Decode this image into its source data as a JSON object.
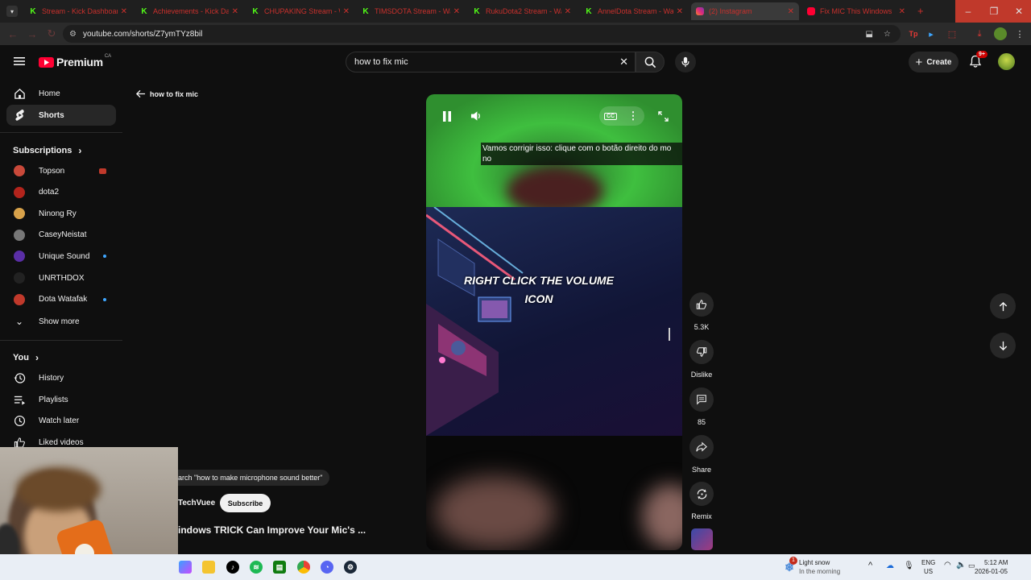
{
  "browser": {
    "tabs": [
      {
        "title": "Stream - Kick Dashboard",
        "favicon": "kick-icon"
      },
      {
        "title": "Achievements - Kick Dash",
        "favicon": "kick-icon"
      },
      {
        "title": "CHUPAKING Stream - Wa",
        "favicon": "kick-icon"
      },
      {
        "title": "TIMSDOTA Stream - Wa",
        "favicon": "kick-icon"
      },
      {
        "title": "RukuDota2 Stream - Wa",
        "favicon": "kick-icon"
      },
      {
        "title": "AnnelDota Stream - Wa",
        "favicon": "kick-icon"
      },
      {
        "title": "(2) Instagram",
        "favicon": "instagram-icon"
      },
      {
        "title": "Fix MIC This Windows",
        "favicon": "youtube-icon"
      }
    ],
    "new_tab": "+",
    "url": "youtube.com/shorts/Z7ymTYz8bil"
  },
  "youtube": {
    "logo_text": "Premium",
    "logo_region": "CA",
    "search_value": "how to fix mic",
    "create_label": "Create",
    "notification_badge": "9+"
  },
  "sidebar": {
    "main": [
      {
        "label": "Home",
        "icon": "home-icon"
      },
      {
        "label": "Shorts",
        "icon": "shorts-icon"
      }
    ],
    "subscriptions_heading": "Subscriptions",
    "subscriptions": [
      {
        "label": "Topson",
        "color": "#c9493a",
        "live": "red"
      },
      {
        "label": "dota2",
        "color": "#b3241c",
        "live": ""
      },
      {
        "label": "Ninong Ry",
        "color": "#d8a24a",
        "live": ""
      },
      {
        "label": "CaseyNeistat",
        "color": "#777777",
        "live": ""
      },
      {
        "label": "Unique Sound",
        "color": "#5a2ea6",
        "live": "blue"
      },
      {
        "label": "UNRTHDOX",
        "color": "#222222",
        "live": ""
      },
      {
        "label": "Dota Watafak",
        "color": "#c0392b",
        "live": "blue"
      }
    ],
    "show_more": "Show more",
    "you_heading": "You",
    "you_items": [
      {
        "label": "History",
        "icon": "history-icon"
      },
      {
        "label": "Playlists",
        "icon": "playlists-icon"
      },
      {
        "label": "Watch later",
        "icon": "watch-later-icon"
      },
      {
        "label": "Liked videos",
        "icon": "like-icon"
      }
    ]
  },
  "shorts": {
    "back_label": "how to fix mic",
    "caption": "Vamos corrigir isso: clique com o botão direito do mo no",
    "overlay_text": "RIGHT CLICK THE VOLUME ICON",
    "search_chip": "arch \"how to make microphone sound better\"",
    "channel": "TechVuee",
    "subscribe_label": "Subscribe",
    "video_title": "indows TRICK Can Improve Your Mic's ...",
    "likes": "5.3K",
    "dislike_label": "Dislike",
    "comments": "85",
    "share_label": "Share",
    "remix_label": "Remix"
  },
  "taskbar": {
    "weather_title": "Light snow",
    "weather_sub": "In the morning",
    "weather_badge": "1",
    "lang": "ENG",
    "region": "US",
    "time": "5:12 AM",
    "date": "2026-01-05"
  }
}
